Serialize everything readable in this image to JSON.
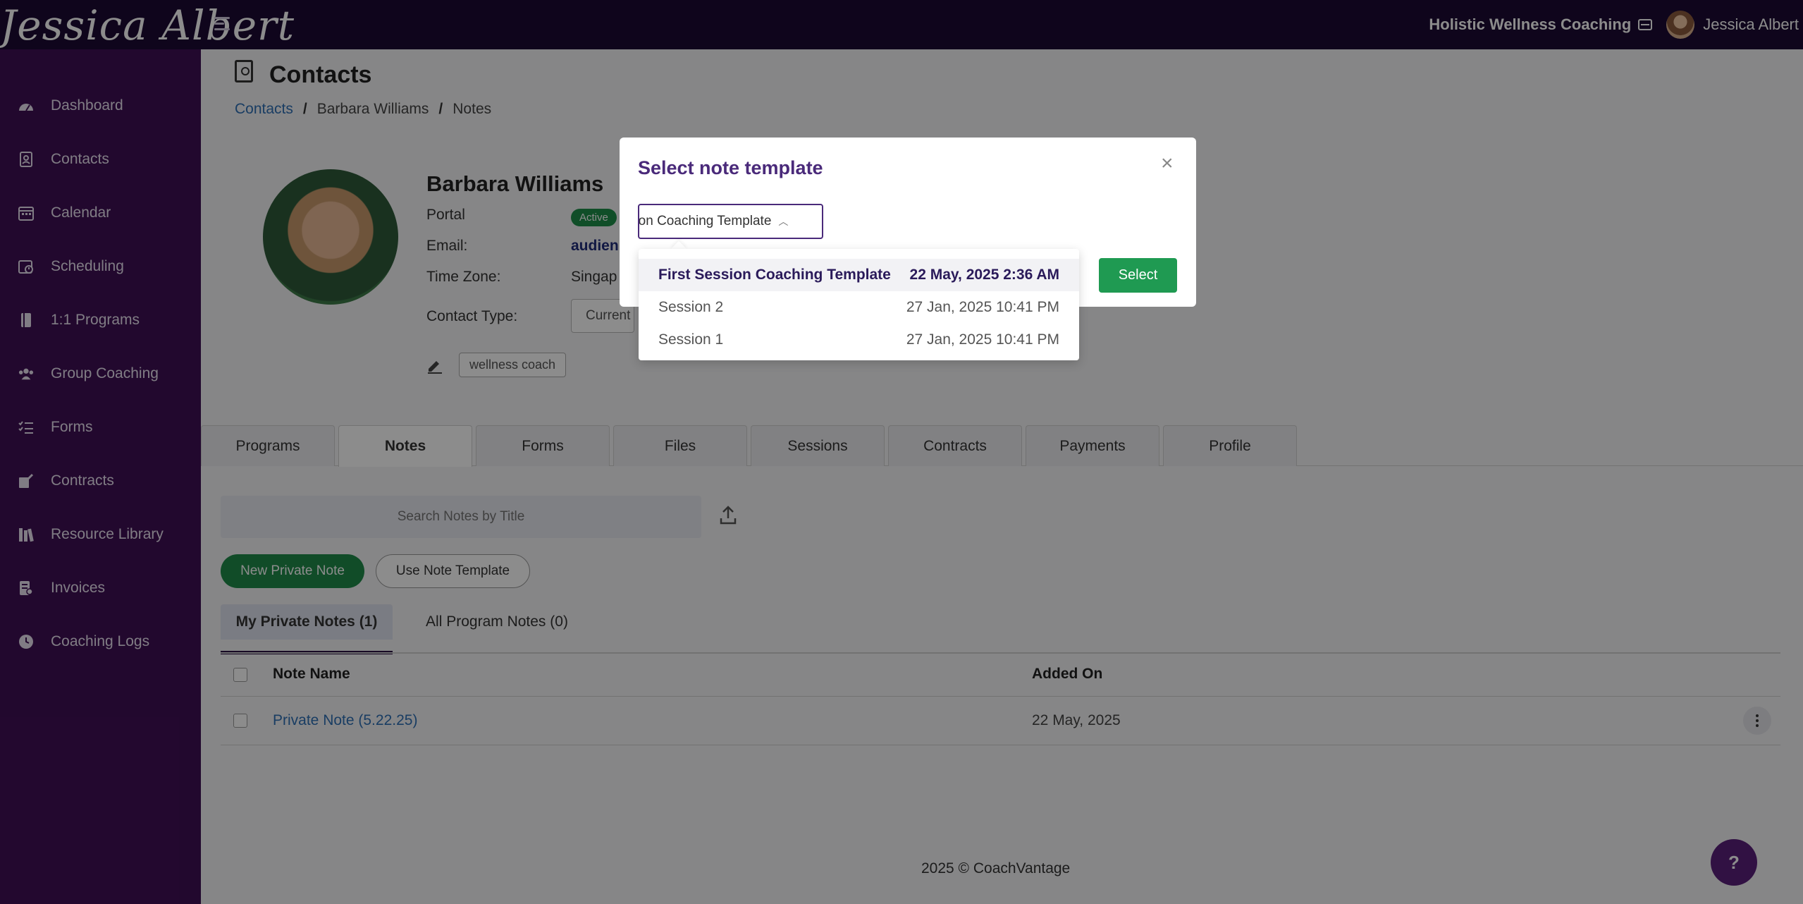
{
  "header": {
    "logo_text": "Jessica Albert",
    "company": "Holistic Wellness Coaching",
    "user_name": "Jessica Albert"
  },
  "sidebar": {
    "items": [
      {
        "label": "Dashboard",
        "icon": "gauge-icon"
      },
      {
        "label": "Contacts",
        "icon": "contact-book-icon"
      },
      {
        "label": "Calendar",
        "icon": "calendar-icon"
      },
      {
        "label": "Scheduling",
        "icon": "schedule-icon"
      },
      {
        "label": "1:1 Programs",
        "icon": "book-icon"
      },
      {
        "label": "Group Coaching",
        "icon": "group-icon"
      },
      {
        "label": "Forms",
        "icon": "checklist-icon"
      },
      {
        "label": "Contracts",
        "icon": "signature-icon"
      },
      {
        "label": "Resource Library",
        "icon": "library-icon"
      },
      {
        "label": "Invoices",
        "icon": "invoice-icon"
      },
      {
        "label": "Coaching Logs",
        "icon": "clock-icon"
      }
    ]
  },
  "page": {
    "title": "Contacts",
    "breadcrumb": [
      "Contacts",
      "Barbara Williams",
      "Notes"
    ]
  },
  "contact": {
    "name": "Barbara Williams",
    "portal_label": "Portal",
    "portal_status": "Active",
    "email_label": "Email:",
    "email_value": "audien",
    "timezone_label": "Time Zone:",
    "timezone_value": "Singap",
    "contact_type_label": "Contact Type:",
    "contact_type_value": "Current C",
    "tag": "wellness coach"
  },
  "tabs": [
    "Programs",
    "Notes",
    "Forms",
    "Files",
    "Sessions",
    "Contracts",
    "Payments",
    "Profile"
  ],
  "active_tab": "Notes",
  "notes": {
    "search_placeholder": "Search Notes by Title",
    "new_note_label": "New Private Note",
    "use_template_label": "Use Note Template",
    "subtabs": [
      "My Private Notes (1)",
      "All Program Notes (0)"
    ],
    "columns": [
      "Note Name",
      "Added On"
    ],
    "rows": [
      {
        "name": "Private Note (5.22.25)",
        "added_on": "22 May, 2025"
      }
    ]
  },
  "footer": {
    "text": "2025 © CoachVantage",
    "help_label": "?"
  },
  "modal": {
    "title": "Select note template",
    "close_label": "×",
    "selected_value": "First Session Coaching Template",
    "select_button": "Select",
    "options": [
      {
        "name": "First Session Coaching Template",
        "date": "22 May, 2025 2:36 AM"
      },
      {
        "name": "Session 2",
        "date": "27 Jan, 2025 10:41 PM"
      },
      {
        "name": "Session 1",
        "date": "27 Jan, 2025 10:41 PM"
      }
    ]
  },
  "colors": {
    "topbar": "#1c0a33",
    "sidebar": "#3f0f55",
    "accent_green": "#1f9a52",
    "modal_title": "#4a2a7a",
    "link_blue": "#2f6fb5"
  }
}
